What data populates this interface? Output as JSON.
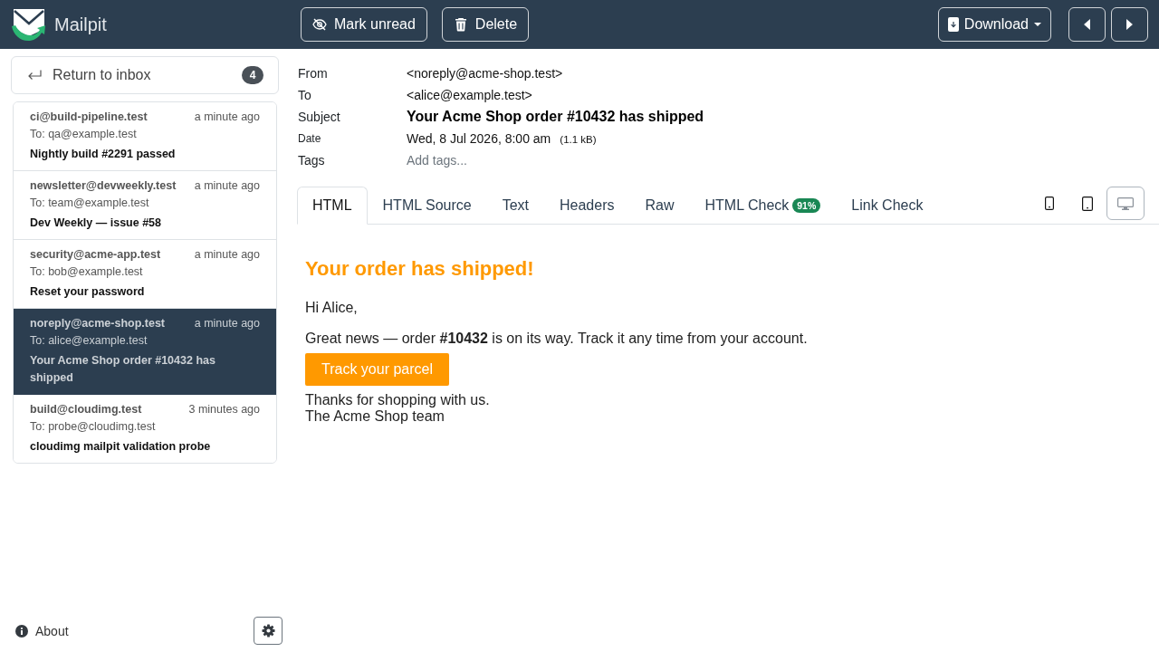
{
  "app": {
    "name": "Mailpit"
  },
  "toolbar": {
    "buttons": [
      {
        "kind": "mark_unread",
        "label": "Mark unread"
      },
      {
        "kind": "delete",
        "label": "Delete"
      }
    ],
    "download": {
      "label": "Download"
    }
  },
  "sidebar": {
    "return_button": {
      "label": "Return to inbox",
      "count": "4"
    },
    "messages": [
      {
        "from": "ci@build-pipeline.test",
        "time": "a minute ago",
        "to": "To: qa@example.test",
        "subject": "Nightly build #2291 passed",
        "selected": false
      },
      {
        "from": "newsletter@devweekly.test",
        "time": "a minute ago",
        "to": "To: team@example.test",
        "subject": "Dev Weekly — issue #58",
        "selected": false
      },
      {
        "from": "security@acme-app.test",
        "time": "a minute ago",
        "to": "To: bob@example.test",
        "subject": "Reset your password",
        "selected": false
      },
      {
        "from": "noreply@acme-shop.test",
        "time": "a minute ago",
        "to": "To: alice@example.test",
        "subject": "Your Acme Shop order #10432 has shipped",
        "selected": true
      },
      {
        "from": "build@cloudimg.test",
        "time": "3 minutes ago",
        "to": "To: probe@cloudimg.test",
        "subject": "cloudimg mailpit validation probe",
        "selected": false
      }
    ],
    "about": {
      "label": "About"
    }
  },
  "message": {
    "headers": [
      {
        "kind": "address",
        "label": "From",
        "value": "<noreply@acme-shop.test>"
      },
      {
        "kind": "address",
        "label": "To",
        "value": "<alice@example.test>"
      },
      {
        "kind": "subject",
        "label": "Subject",
        "value": "Your Acme Shop order #10432 has shipped"
      },
      {
        "kind": "date",
        "label": "Date",
        "value": "Wed, 8 Jul 2026, 8:00 am",
        "size": "(1.1 kB)"
      },
      {
        "kind": "tags",
        "label": "Tags",
        "placeholder": "Add tags..."
      }
    ],
    "tabs": [
      {
        "label": "HTML",
        "selected": true
      },
      {
        "label": "HTML Source",
        "selected": false
      },
      {
        "label": "Text",
        "selected": false
      },
      {
        "label": "Headers",
        "selected": false
      },
      {
        "label": "Raw",
        "selected": false
      },
      {
        "label": "HTML Check",
        "selected": false,
        "badge": "91%"
      },
      {
        "label": "Link Check",
        "selected": false
      }
    ],
    "view_modes": [
      {
        "kind": "phone",
        "selected": false
      },
      {
        "kind": "tablet",
        "selected": false
      },
      {
        "kind": "desktop",
        "selected": true
      }
    ],
    "body": {
      "heading": "Your order has shipped!",
      "greeting": "Hi Alice,",
      "paragraph": "Great news — order **#10432** is on its way. Track it any time from your account.",
      "button": "Track your parcel",
      "closing": [
        "Thanks for shopping with us.",
        "The Acme Shop team"
      ]
    }
  }
}
